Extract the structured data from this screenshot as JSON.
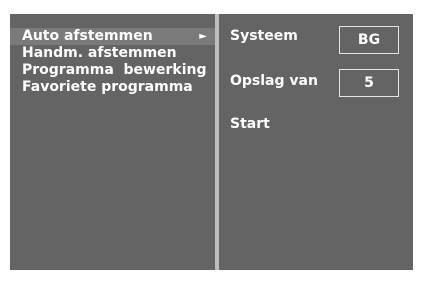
{
  "menu": {
    "items": [
      {
        "label": "Auto afstemmen",
        "arrow": "►"
      },
      {
        "label": "Handm. afstemmen"
      },
      {
        "label": "Programma  bewerking"
      },
      {
        "label": "Favoriete programma"
      }
    ]
  },
  "settings": {
    "system": {
      "label": "Systeem",
      "value": "BG"
    },
    "storage": {
      "label": "Opslag van",
      "value": "5"
    },
    "start": {
      "label": "Start"
    }
  },
  "colors": {
    "panel": "#646464",
    "highlight": "#7a7a7a",
    "divider": "#bdbdbd",
    "text": "#ffffff"
  }
}
